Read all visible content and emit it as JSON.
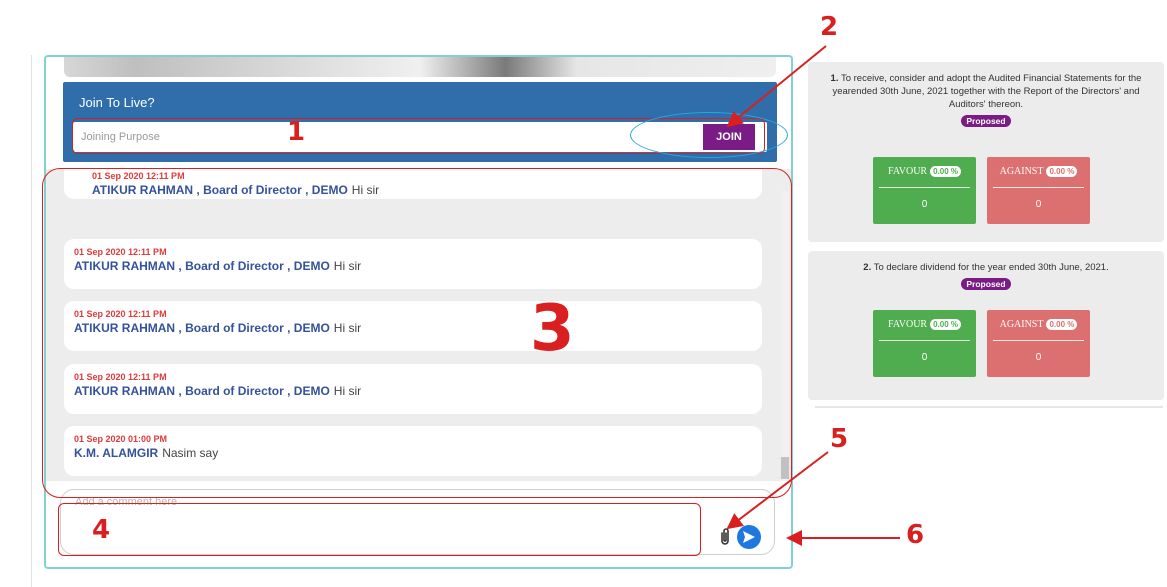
{
  "join": {
    "title": "Join To Live?",
    "placeholder": "Joining Purpose",
    "button_label": "JOIN"
  },
  "chat": {
    "messages": [
      {
        "time": "01 Sep 2020 12:11 PM",
        "author": "ATIKUR RAHMAN , Board of Director , DEMO",
        "text": "Hi sir"
      },
      {
        "time": "01 Sep 2020 12:11 PM",
        "author": "ATIKUR RAHMAN , Board of Director , DEMO",
        "text": "Hi sir"
      },
      {
        "time": "01 Sep 2020 12:11 PM",
        "author": "ATIKUR RAHMAN , Board of Director , DEMO",
        "text": "Hi sir"
      },
      {
        "time": "01 Sep 2020 12:11 PM",
        "author": "ATIKUR RAHMAN , Board of Director , DEMO",
        "text": "Hi sir"
      },
      {
        "time": "01 Sep 2020 01:00 PM",
        "author": "K.M. ALAMGIR",
        "text": "Nasim say"
      }
    ]
  },
  "comment": {
    "placeholder": "Add a comment here"
  },
  "icons": {
    "attach": "paperclip-icon",
    "send": "send-icon"
  },
  "agenda": [
    {
      "number": "1.",
      "text": "To receive, consider and adopt the Audited Financial Statements for the yearended 30th June, 2021 together with the Report of the Directors' and Auditors' thereon.",
      "status": "Proposed",
      "favour_label": "FAVOUR",
      "favour_pct": "0.00 %",
      "favour_count": "0",
      "against_label": "AGAINST",
      "against_pct": "0.00 %",
      "against_count": "0"
    },
    {
      "number": "2.",
      "text": "To declare dividend for the year ended 30th June, 2021.",
      "status": "Proposed",
      "favour_label": "FAVOUR",
      "favour_pct": "0.00 %",
      "favour_count": "0",
      "against_label": "AGAINST",
      "against_pct": "0.00 %",
      "against_count": "0"
    }
  ],
  "annotations": {
    "n1": "1",
    "n2": "2",
    "n3": "3",
    "n4": "4",
    "n5": "5",
    "n6": "6"
  },
  "colors": {
    "join_panel": "#2f6eaa",
    "join_button": "#7a1b86",
    "timestamp": "#e03a3a",
    "author": "#34519c",
    "favour": "#4fad4f",
    "against": "#dc6f6f",
    "annotation": "#d91f1f",
    "highlight": "#29a7e1"
  }
}
